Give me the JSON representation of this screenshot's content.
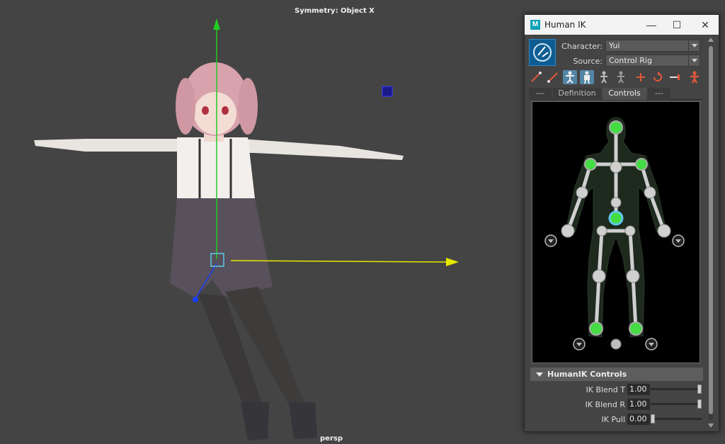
{
  "viewport": {
    "symmetry_label": "Symmetry: Object X",
    "camera_label": "persp",
    "colors": {
      "background": "#444444",
      "y_axis": "#22cc22",
      "x_axis": "#e8e800",
      "z_axis": "#1a3cff"
    }
  },
  "window": {
    "title": "Human IK",
    "app_icon": "maya-icon",
    "controls": {
      "minimize": "—",
      "maximize": "☐",
      "close": "✕"
    }
  },
  "character": {
    "label": "Character:",
    "value": "Yui"
  },
  "source": {
    "label": "Source:",
    "value": "Control Rig"
  },
  "toolbar": {
    "tools": [
      "create-skeleton-icon",
      "edit-skeleton-icon",
      "full-body-icon",
      "body-part-icon",
      "selection-icon",
      "pinning-icon",
      "add-pin-icon",
      "reset-icon",
      "mirror-icon",
      "figure-icon"
    ]
  },
  "tabs": [
    {
      "label": "---"
    },
    {
      "label": "Definition"
    },
    {
      "label": "Controls",
      "active": true
    },
    {
      "label": "---"
    }
  ],
  "controls_section": {
    "title": "HumanIK Controls",
    "rows": [
      {
        "label": "IK Blend T",
        "value": "1.00",
        "level": 1.0
      },
      {
        "label": "IK Blend R",
        "value": "1.00",
        "level": 1.0
      },
      {
        "label": "IK Pull",
        "value": "0.00",
        "level": 0.0
      }
    ]
  },
  "colors": {
    "accent": "#5285a6",
    "active_node": "#44dd44",
    "rig_bg": "#000000"
  }
}
